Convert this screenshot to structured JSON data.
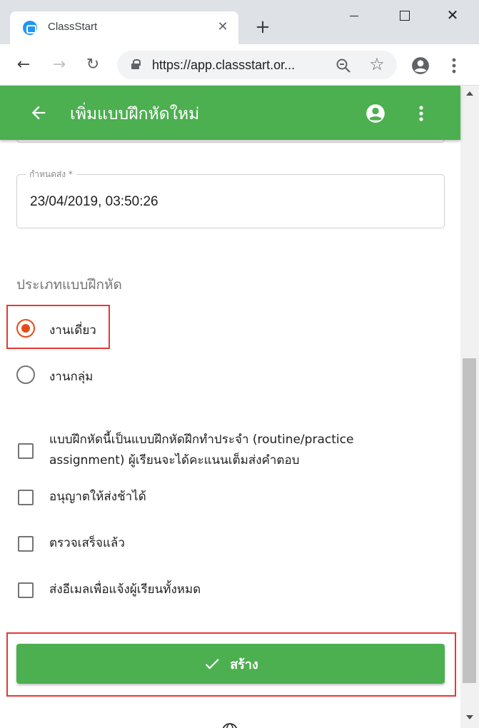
{
  "browser": {
    "tab_title": "ClassStart",
    "tab_close": "✕",
    "new_tab": "+",
    "window_close": "✕",
    "url": "https://app.classstart.or...",
    "nav_back": "←",
    "nav_forward": "→",
    "nav_reload": "↻",
    "star": "☆"
  },
  "appbar": {
    "title": "เพิ่มแบบฝึกหัดใหม่"
  },
  "form": {
    "deadline": {
      "label": "กำหนดส่ง *",
      "value": "23/04/2019, 03:50:26"
    },
    "assignment_type": {
      "title": "ประเภทแบบฝึกหัด",
      "options": [
        {
          "label": "งานเดี่ยว",
          "checked": true
        },
        {
          "label": "งานกลุ่ม",
          "checked": false
        }
      ]
    },
    "checkboxes": [
      {
        "label": "แบบฝึกหัดนี้เป็นแบบฝึกหัดฝึกทำประจำ (routine/practice assignment) ผู้เรียนจะได้คะแนนเต็มส่งคำตอบ",
        "checked": false
      },
      {
        "label": "อนุญาตให้ส่งช้าได้",
        "checked": false
      },
      {
        "label": "ตรวจเสร็จแล้ว",
        "checked": false
      },
      {
        "label": "ส่งอีเมลเพื่อแจ้งผู้เรียนทั้งหมด",
        "checked": false
      }
    ],
    "submit_label": "สร้าง"
  },
  "colors": {
    "primary_green": "#4caf50",
    "radio_accent": "#e64a19",
    "highlight_red": "#e53935"
  },
  "icons": [
    "classstart-favicon",
    "lock-icon",
    "zoom-icon",
    "star-icon",
    "profile-icon",
    "menu-icon",
    "back-arrow-icon",
    "account-circle-icon",
    "more-vert-icon",
    "check-icon",
    "globe-icon"
  ]
}
